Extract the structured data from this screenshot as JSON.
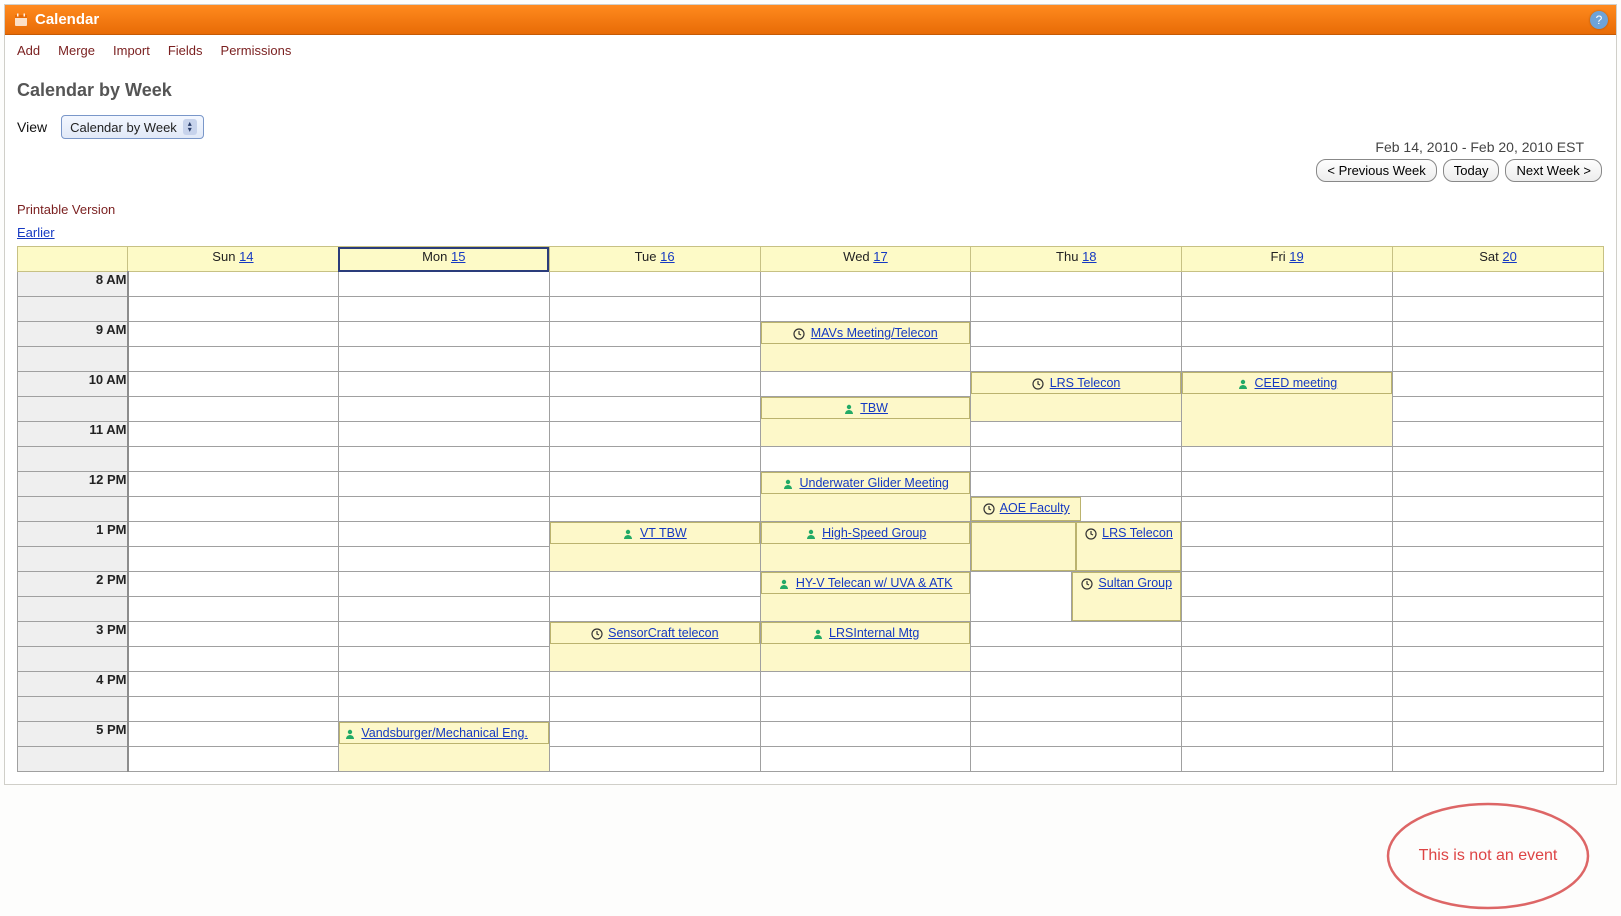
{
  "header": {
    "title": "Calendar"
  },
  "menu": {
    "add": "Add",
    "merge": "Merge",
    "import": "Import",
    "fields": "Fields",
    "permissions": "Permissions"
  },
  "subheader": {
    "title": "Calendar by Week",
    "view_label": "View",
    "view_value": "Calendar by Week",
    "date_range": "Feb 14, 2010 - Feb 20, 2010 EST",
    "prev_btn": "< Previous Week",
    "today_btn": "Today",
    "next_btn": "Next Week >",
    "printable": "Printable Version",
    "earlier": "Earlier"
  },
  "days": {
    "sun": {
      "label": "Sun",
      "num": "14"
    },
    "mon": {
      "label": "Mon",
      "num": "15"
    },
    "tue": {
      "label": "Tue",
      "num": "16"
    },
    "wed": {
      "label": "Wed",
      "num": "17"
    },
    "thu": {
      "label": "Thu",
      "num": "18"
    },
    "fri": {
      "label": "Fri",
      "num": "19"
    },
    "sat": {
      "label": "Sat",
      "num": "20"
    }
  },
  "times": {
    "h8": "8 AM",
    "h9": "9 AM",
    "h10": "10 AM",
    "h11": "11 AM",
    "h12": "12 PM",
    "h13": "1 PM",
    "h14": "2 PM",
    "h15": "3 PM",
    "h16": "4 PM",
    "h17": "5 PM"
  },
  "events": {
    "mavs": "MAVs Meeting/Telecon",
    "lrs_telecon": "LRS Telecon",
    "ceed": "CEED meeting",
    "tbw": "TBW",
    "underwater": "Underwater Glider Meeting",
    "aoe_faculty": "AOE Faculty",
    "vt_tbw": "VT TBW",
    "highspeed": "High-Speed Group",
    "lrs_telecon2": "LRS Telecon",
    "hyv": "HY-V Telecan w/ UVA & ATK",
    "sultan": "Sultan Group",
    "sensorcraft": "SensorCraft telecon",
    "lrs_internal": "LRSInternal Mtg",
    "vandsburger": "Vandsburger/Mechanical Eng."
  },
  "callout": {
    "text": "This is not an event"
  }
}
